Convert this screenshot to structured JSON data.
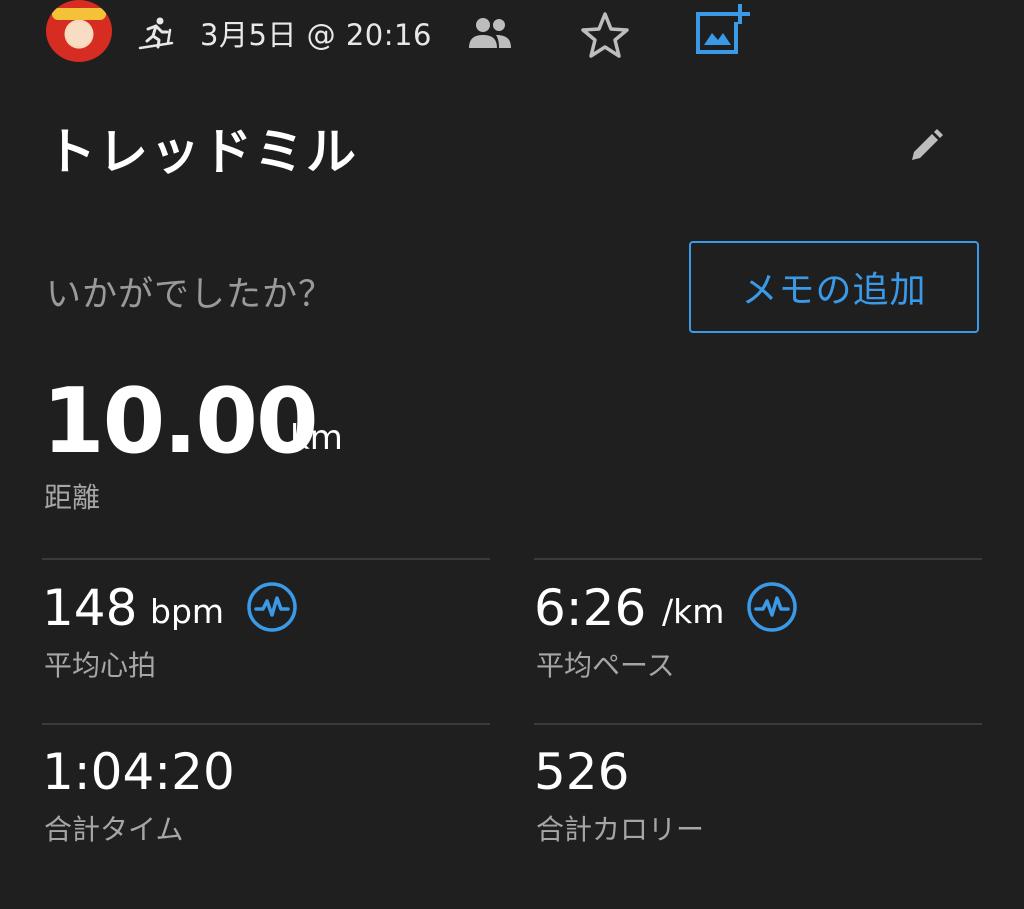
{
  "header": {
    "date_text": "3月5日 @ 20:16",
    "icons": [
      "avatar",
      "treadmill-running-icon",
      "people-icon",
      "star-icon",
      "add-photo-icon"
    ]
  },
  "title": "トレッドミル",
  "prompt": "いかがでしたか？",
  "memo_button": "メモの追加",
  "distance": {
    "value": "10.00",
    "unit": "km",
    "label": "距離"
  },
  "metrics": {
    "heart_rate": {
      "value": "148",
      "unit": "bpm",
      "label": "平均心拍"
    },
    "pace": {
      "value": "6:26",
      "unit": "/km",
      "label": "平均ペース"
    },
    "total_time": {
      "value": "1:04:20",
      "label": "合計タイム"
    },
    "calories": {
      "value": "526",
      "label": "合計カロリー"
    }
  },
  "colors": {
    "background": "#1f1f20",
    "accent": "#3b9ae8",
    "label": "#a6a6a6"
  }
}
